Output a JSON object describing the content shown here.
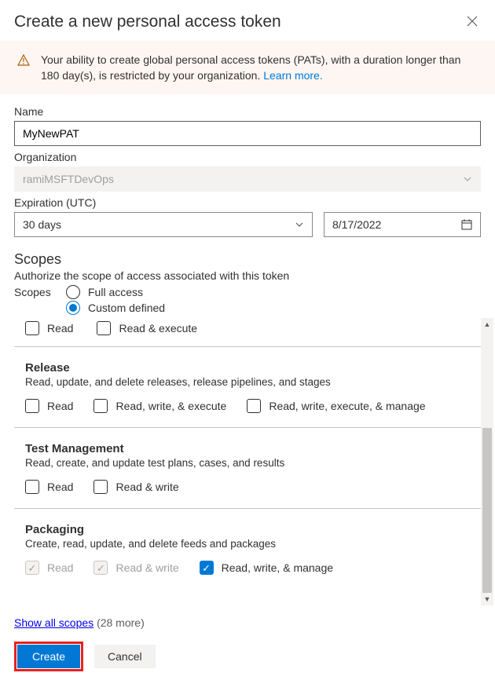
{
  "title": "Create a new personal access token",
  "alert": {
    "text": "Your ability to create global personal access tokens (PATs), with a duration longer than 180 day(s), is restricted by your organization. ",
    "link": "Learn more."
  },
  "fields": {
    "name_label": "Name",
    "name_value": "MyNewPAT",
    "org_label": "Organization",
    "org_value": "ramiMSFTDevOps",
    "exp_label": "Expiration (UTC)",
    "exp_duration": "30 days",
    "exp_date": "8/17/2022"
  },
  "scopes": {
    "title": "Scopes",
    "subtitle": "Authorize the scope of access associated with this token",
    "radio_label": "Scopes",
    "full_label": "Full access",
    "custom_label": "Custom defined",
    "selected": "custom"
  },
  "partial": {
    "opts": [
      "Read",
      "Read & execute"
    ]
  },
  "groups": [
    {
      "name": "Release",
      "desc": "Read, update, and delete releases, release pipelines, and stages",
      "opts": [
        {
          "label": "Read",
          "checked": false,
          "disabled": false
        },
        {
          "label": "Read, write, & execute",
          "checked": false,
          "disabled": false
        },
        {
          "label": "Read, write, execute, & manage",
          "checked": false,
          "disabled": false
        }
      ]
    },
    {
      "name": "Test Management",
      "desc": "Read, create, and update test plans, cases, and results",
      "opts": [
        {
          "label": "Read",
          "checked": false,
          "disabled": false
        },
        {
          "label": "Read & write",
          "checked": false,
          "disabled": false
        }
      ]
    },
    {
      "name": "Packaging",
      "desc": "Create, read, update, and delete feeds and packages",
      "opts": [
        {
          "label": "Read",
          "checked": true,
          "disabled": true
        },
        {
          "label": "Read & write",
          "checked": true,
          "disabled": true
        },
        {
          "label": "Read, write, & manage",
          "checked": true,
          "disabled": false
        }
      ]
    }
  ],
  "footer": {
    "show_all": "Show all scopes",
    "count": "(28 more)",
    "create": "Create",
    "cancel": "Cancel"
  }
}
